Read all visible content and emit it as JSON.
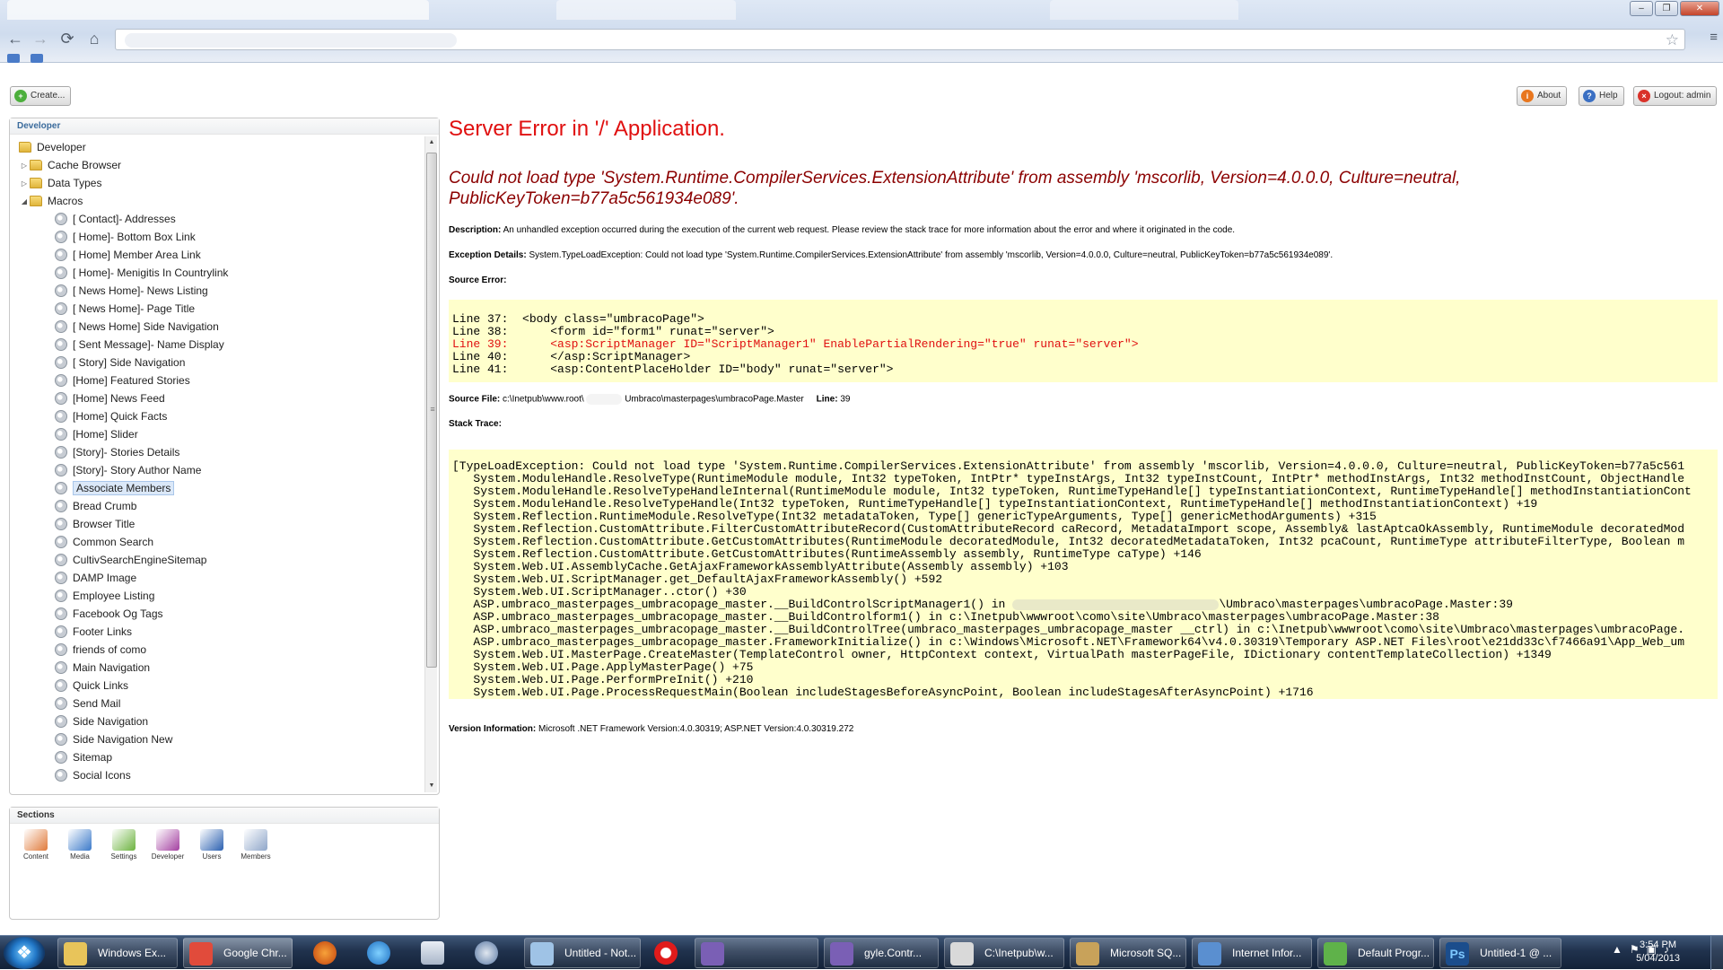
{
  "browser": {
    "nav": {
      "back": "←",
      "forward": "→",
      "reload": "⟳",
      "home": "⌂"
    },
    "star": "☆",
    "menu": "≡"
  },
  "toolbar": {
    "create_label": "Create...",
    "about_label": "About",
    "help_label": "Help",
    "logout_label": "Logout: admin"
  },
  "tree": {
    "header": "Developer",
    "root": "Developer",
    "items": [
      {
        "label": "Cache Browser",
        "type": "folder",
        "expander": "▷"
      },
      {
        "label": "Data Types",
        "type": "folder",
        "expander": "▷"
      },
      {
        "label": "Macros",
        "type": "folder",
        "expander": "◢"
      },
      {
        "label": "[ Contact]- Addresses",
        "type": "macro"
      },
      {
        "label": "[ Home]- Bottom Box Link",
        "type": "macro"
      },
      {
        "label": "[ Home] Member Area Link",
        "type": "macro"
      },
      {
        "label": "[ Home]- Menigitis In Countrylink",
        "type": "macro"
      },
      {
        "label": "[ News Home]- News Listing",
        "type": "macro"
      },
      {
        "label": "[ News Home]- Page Title",
        "type": "macro"
      },
      {
        "label": "[ News Home] Side Navigation",
        "type": "macro"
      },
      {
        "label": "[ Sent Message]- Name Display",
        "type": "macro"
      },
      {
        "label": "[ Story] Side Navigation",
        "type": "macro"
      },
      {
        "label": "[Home] Featured Stories",
        "type": "macro"
      },
      {
        "label": "[Home] News Feed",
        "type": "macro"
      },
      {
        "label": "[Home] Quick Facts",
        "type": "macro"
      },
      {
        "label": "[Home] Slider",
        "type": "macro"
      },
      {
        "label": "[Story]- Stories Details",
        "type": "macro"
      },
      {
        "label": "[Story]- Story Author Name",
        "type": "macro"
      },
      {
        "label": "Associate Members",
        "type": "macro",
        "selected": true
      },
      {
        "label": "Bread Crumb",
        "type": "macro"
      },
      {
        "label": "Browser Title",
        "type": "macro"
      },
      {
        "label": "Common Search",
        "type": "macro"
      },
      {
        "label": "CultivSearchEngineSitemap",
        "type": "macro"
      },
      {
        "label": "DAMP Image",
        "type": "macro"
      },
      {
        "label": "Employee Listing",
        "type": "macro"
      },
      {
        "label": "Facebook Og Tags",
        "type": "macro"
      },
      {
        "label": "Footer Links",
        "type": "macro"
      },
      {
        "label": "friends of como",
        "type": "macro"
      },
      {
        "label": "Main Navigation",
        "type": "macro"
      },
      {
        "label": "Quick Links",
        "type": "macro"
      },
      {
        "label": "Send Mail",
        "type": "macro"
      },
      {
        "label": "Side Navigation",
        "type": "macro"
      },
      {
        "label": "Side Navigation New",
        "type": "macro"
      },
      {
        "label": "Sitemap",
        "type": "macro"
      },
      {
        "label": "Social Icons",
        "type": "macro"
      }
    ],
    "scroll_arrows": {
      "up": "▲",
      "down": "▼",
      "grip": "≡"
    }
  },
  "sections": {
    "header": "Sections",
    "items": [
      {
        "label": "Content",
        "color": "#e07a3a"
      },
      {
        "label": "Media",
        "color": "#3a79c9"
      },
      {
        "label": "Settings",
        "color": "#6cb33f"
      },
      {
        "label": "Developer",
        "color": "#a33fa0"
      },
      {
        "label": "Users",
        "color": "#2a5fb0"
      },
      {
        "label": "Members",
        "color": "#8fa6c9"
      }
    ]
  },
  "error": {
    "title": "Server Error in '/' Application.",
    "message": "Could not load type 'System.Runtime.CompilerServices.ExtensionAttribute' from assembly 'mscorlib, Version=4.0.0.0, Culture=neutral, PublicKeyToken=b77a5c561934e089'.",
    "description_label": "Description:",
    "description": "An unhandled exception occurred during the execution of the current web request. Please review the stack trace for more information about the error and where it originated in the code.",
    "exception_label": "Exception Details:",
    "exception": "System.TypeLoadException: Could not load type 'System.Runtime.CompilerServices.ExtensionAttribute' from assembly 'mscorlib, Version=4.0.0.0, Culture=neutral, PublicKeyToken=b77a5c561934e089'.",
    "source_error_label": "Source Error:",
    "source_lines": [
      {
        "text": "Line 37:  <body class=\"umbracoPage\">",
        "highlight": false
      },
      {
        "text": "Line 38:      <form id=\"form1\" runat=\"server\">",
        "highlight": false
      },
      {
        "text": "Line 39:      <asp:ScriptManager ID=\"ScriptManager1\" EnablePartialRendering=\"true\" runat=\"server\">",
        "highlight": true
      },
      {
        "text": "Line 40:      </asp:ScriptManager>",
        "highlight": false
      },
      {
        "text": "Line 41:      <asp:ContentPlaceHolder ID=\"body\" runat=\"server\">",
        "highlight": false
      }
    ],
    "source_file_label": "Source File:",
    "source_file_a": "c:\\Inetpub\\www.root\\",
    "source_file_b": "Umbraco\\masterpages\\umbracoPage.Master",
    "line_label": "Line:",
    "line_value": "39",
    "stack_label": "Stack Trace:",
    "stack_lines": [
      "[TypeLoadException: Could not load type 'System.Runtime.CompilerServices.ExtensionAttribute' from assembly 'mscorlib, Version=4.0.0.0, Culture=neutral, PublicKeyToken=b77a5c561",
      "   System.ModuleHandle.ResolveType(RuntimeModule module, Int32 typeToken, IntPtr* typeInstArgs, Int32 typeInstCount, IntPtr* methodInstArgs, Int32 methodInstCount, ObjectHandle",
      "   System.ModuleHandle.ResolveTypeHandleInternal(RuntimeModule module, Int32 typeToken, RuntimeTypeHandle[] typeInstantiationContext, RuntimeTypeHandle[] methodInstantiationCont",
      "   System.ModuleHandle.ResolveTypeHandle(Int32 typeToken, RuntimeTypeHandle[] typeInstantiationContext, RuntimeTypeHandle[] methodInstantiationContext) +19",
      "   System.Reflection.RuntimeModule.ResolveType(Int32 metadataToken, Type[] genericTypeArguments, Type[] genericMethodArguments) +315",
      "   System.Reflection.CustomAttribute.FilterCustomAttributeRecord(CustomAttributeRecord caRecord, MetadataImport scope, Assembly& lastAptcaOkAssembly, RuntimeModule decoratedMod",
      "   System.Reflection.CustomAttribute.GetCustomAttributes(RuntimeModule decoratedModule, Int32 decoratedMetadataToken, Int32 pcaCount, RuntimeType attributeFilterType, Boolean m",
      "   System.Reflection.CustomAttribute.GetCustomAttributes(RuntimeAssembly assembly, RuntimeType caType) +146",
      "   System.Web.UI.AssemblyCache.GetAjaxFrameworkAssemblyAttribute(Assembly assembly) +103",
      "   System.Web.UI.ScriptManager.get_DefaultAjaxFrameworkAssembly() +592",
      "   System.Web.UI.ScriptManager..ctor() +30",
      "   ASP.umbraco_masterpages_umbracopage_master.__BuildControlScriptManager1() in",
      "   ASP.umbraco_masterpages_umbracopage_master.__BuildControlform1() in c:\\Inetpub\\wwwroot\\como\\site\\Umbraco\\masterpages\\umbracoPage.Master:38",
      "   ASP.umbraco_masterpages_umbracopage_master.__BuildControlTree(umbraco_masterpages_umbracopage_master __ctrl) in c:\\Inetpub\\wwwroot\\como\\site\\Umbraco\\masterpages\\umbracoPage.",
      "   ASP.umbraco_masterpages_umbracopage_master.FrameworkInitialize() in c:\\Windows\\Microsoft.NET\\Framework64\\v4.0.30319\\Temporary ASP.NET Files\\root\\e21dd33c\\f7466a91\\App_Web_um",
      "   System.Web.UI.MasterPage.CreateMaster(TemplateControl owner, HttpContext context, VirtualPath masterPageFile, IDictionary contentTemplateCollection) +1349",
      "   System.Web.UI.Page.ApplyMasterPage() +75",
      "   System.Web.UI.Page.PerformPreInit() +210",
      "   System.Web.UI.Page.ProcessRequestMain(Boolean includeStagesBeforeAsyncPoint, Boolean includeStagesAfterAsyncPoint) +1716"
    ],
    "stack_line11_tail": "\\Umbraco\\masterpages\\umbracoPage.Master:39",
    "version_label": "Version Information:",
    "version": "Microsoft .NET Framework Version:4.0.30319; ASP.NET Version:4.0.30319.272"
  },
  "taskbar": {
    "start_glyph": "❖",
    "buttons": [
      {
        "label": "Windows Ex...",
        "color": "#e8c45a"
      },
      {
        "label": "Google Chr...",
        "color": "#e14b3b",
        "active": true
      },
      {
        "label": "Untitled - Not...",
        "color": "#9fc3e6"
      },
      {
        "label": "gyle.Contr...",
        "color": "#7a5fb5"
      },
      {
        "label": "C:\\Inetpub\\w...",
        "color": "#d9d9d9"
      },
      {
        "label": "Microsoft SQ...",
        "color": "#c8a25a"
      },
      {
        "label": "Internet Infor...",
        "color": "#5a8fd0"
      },
      {
        "label": "Default Progr...",
        "color": "#5fb24a"
      },
      {
        "label": "Untitled-1 @ ...",
        "color": "#1b4d8c"
      }
    ],
    "ps_glyph": "Ps",
    "tray_icons": [
      "▲",
      "⚑",
      "▣",
      "♪"
    ],
    "time": "3:54 PM",
    "date": "5/04/2013"
  }
}
